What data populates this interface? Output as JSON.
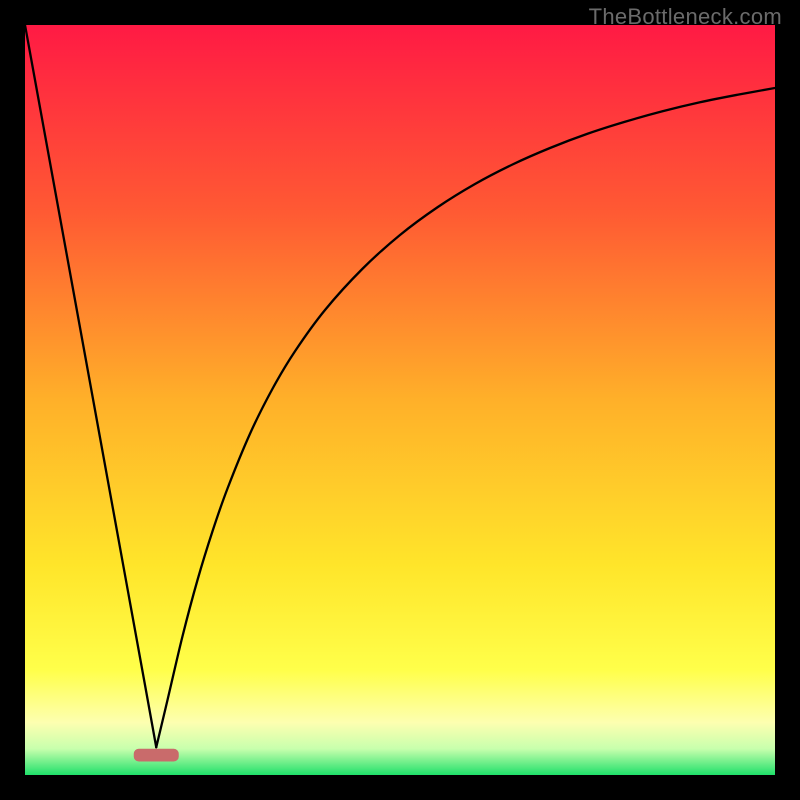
{
  "watermark": "TheBottleneck.com",
  "chart_data": {
    "type": "line",
    "title": "",
    "xlabel": "",
    "ylabel": "",
    "xlim": [
      0,
      100
    ],
    "ylim": [
      0,
      100
    ],
    "grid": false,
    "legend": false,
    "gradient_stops": [
      {
        "offset": 0.0,
        "color": "#ff1a44"
      },
      {
        "offset": 0.25,
        "color": "#ff5a33"
      },
      {
        "offset": 0.5,
        "color": "#ffb029"
      },
      {
        "offset": 0.72,
        "color": "#ffe52a"
      },
      {
        "offset": 0.86,
        "color": "#ffff4a"
      },
      {
        "offset": 0.93,
        "color": "#fdffb0"
      },
      {
        "offset": 0.965,
        "color": "#c8ffad"
      },
      {
        "offset": 1.0,
        "color": "#1fe06a"
      }
    ],
    "bottom_band": {
      "y_top": 96.5,
      "y_bottom": 98.2,
      "highlight": {
        "x_start": 14.5,
        "x_end": 20.5,
        "color": "#c96b6b"
      }
    },
    "series": [
      {
        "name": "left-limb",
        "type": "line",
        "x": [
          0.0,
          2.0,
          4.0,
          6.0,
          8.0,
          10.0,
          12.0,
          14.0,
          16.0,
          17.5
        ],
        "y": [
          0.0,
          11.0,
          22.0,
          33.0,
          44.0,
          55.0,
          66.0,
          77.0,
          88.0,
          96.3
        ]
      },
      {
        "name": "right-limb",
        "type": "line",
        "x": [
          17.5,
          19,
          21,
          23,
          25,
          27,
          30,
          33,
          36,
          40,
          45,
          50,
          55,
          60,
          65,
          70,
          75,
          80,
          85,
          90,
          95,
          100
        ],
        "y": [
          96.3,
          90.0,
          81.5,
          74.0,
          67.5,
          61.8,
          54.5,
          48.5,
          43.5,
          38.0,
          32.5,
          28.0,
          24.3,
          21.2,
          18.6,
          16.4,
          14.5,
          12.9,
          11.5,
          10.3,
          9.3,
          8.4
        ]
      }
    ],
    "notes": "y-axis inverted visually: y=0 at top of plot, y=100 at bottom. No axis ticks or labels are shown in the image."
  }
}
